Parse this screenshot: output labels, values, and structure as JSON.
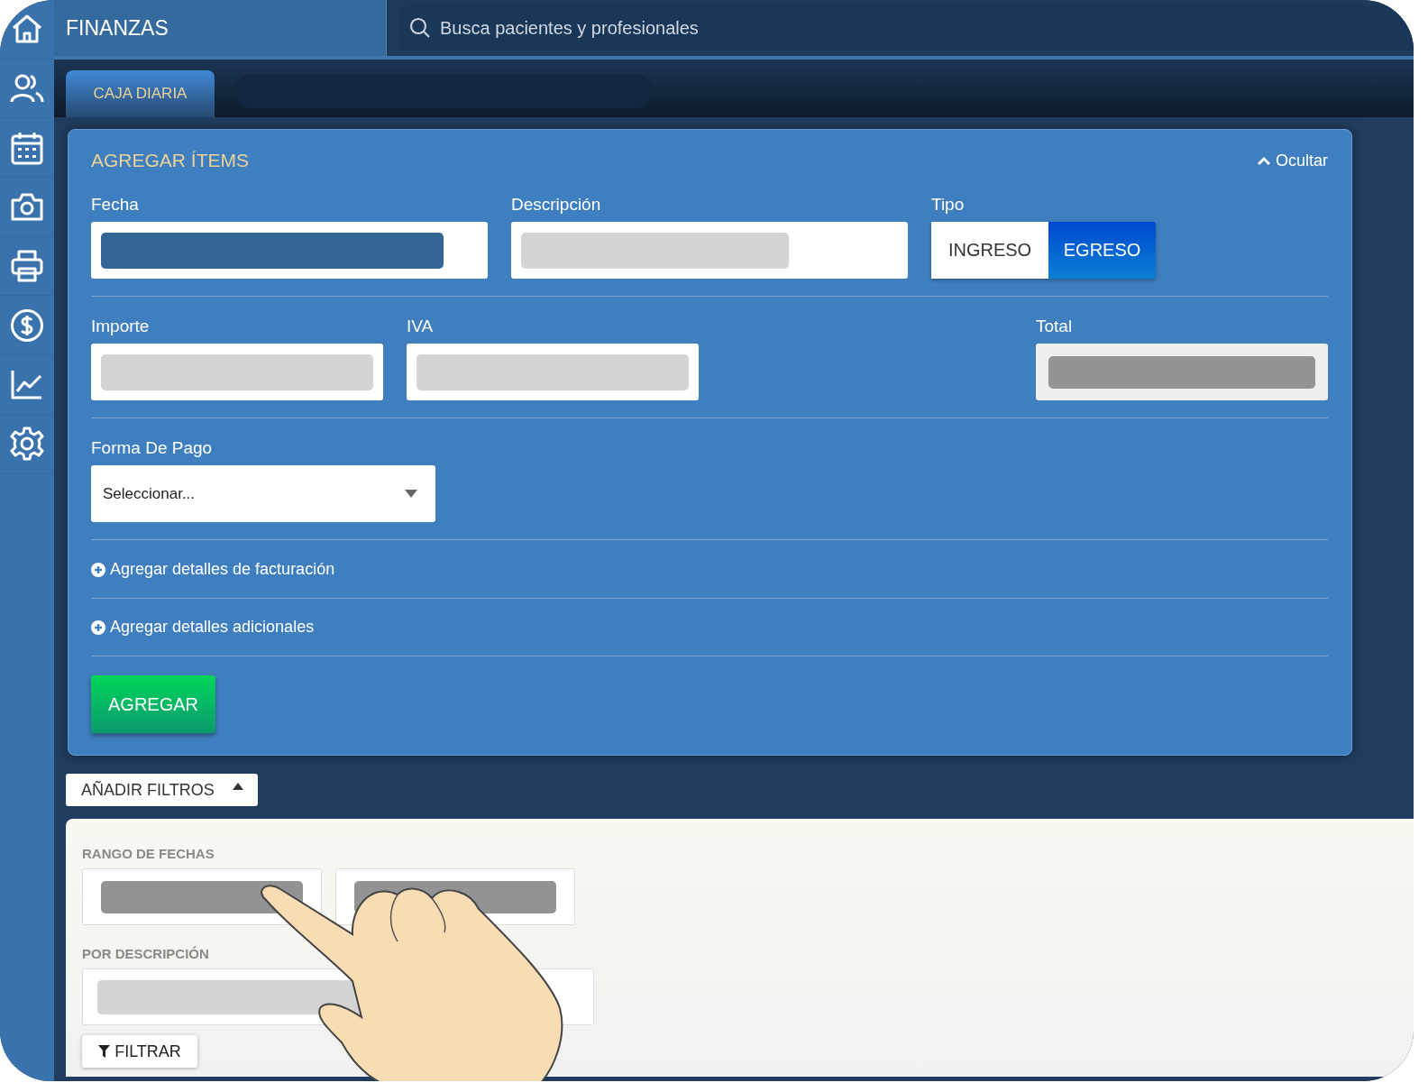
{
  "header": {
    "title": "FINANZAS",
    "search": {
      "placeholder": "Busca pacientes y profesionales"
    }
  },
  "tabs": [
    {
      "label": "CAJA DIARIA",
      "selected": true
    }
  ],
  "form": {
    "title": "AGREGAR ÍTEMS",
    "toggle": "Ocultar",
    "expanded": true,
    "rows": [
      {
        "fields": [
          {
            "label": "Fecha",
            "kind": "date"
          },
          {
            "label": "Descripción",
            "kind": "text"
          },
          {
            "label": "Tipo",
            "kind": "toggle",
            "options": [
              {
                "label": "INGRESO",
                "selected": false
              },
              {
                "label": "EGRESO",
                "selected": true
              }
            ]
          }
        ]
      },
      {
        "fields": [
          {
            "label": "Importe",
            "kind": "text"
          },
          {
            "label": "IVA",
            "kind": "text"
          },
          {
            "label": "Total",
            "kind": "readonly"
          }
        ]
      },
      {
        "fields": [
          {
            "label": "Forma De Pago",
            "kind": "select",
            "placeholder": "Seleccionar..."
          }
        ]
      }
    ],
    "expanders": [
      {
        "label": "Agregar detalles de facturación"
      },
      {
        "label": "Agregar detalles adicionales"
      }
    ],
    "submit": "AGREGAR"
  },
  "filters": {
    "button": "AÑADIR FILTROS",
    "expanded": true,
    "groups": [
      {
        "label": "RANGO DE FECHAS",
        "kind": "range"
      },
      {
        "label": "POR DESCRIPCIÓN",
        "kind": "text"
      }
    ],
    "submit": "FILTRAR"
  }
}
